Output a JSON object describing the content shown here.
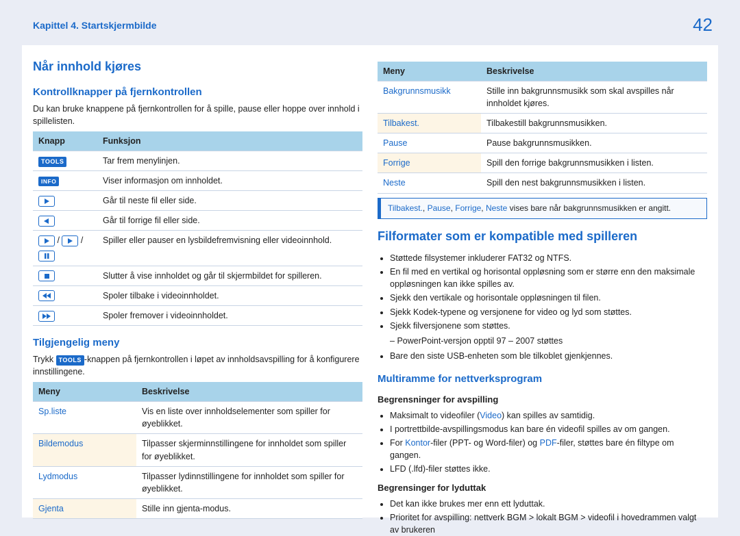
{
  "header": {
    "chapter": "Kapittel 4. Startskjermbilde",
    "page_number": "42"
  },
  "left": {
    "h1": "Når innhold kjøres",
    "h2a": "Kontrollknapper på fjernkontrollen",
    "intro": "Du kan bruke knappene på fjernkontrollen for å spille, pause eller hoppe over innhold i spillelisten.",
    "table1": {
      "col1": "Knapp",
      "col2": "Funksjon",
      "rows": [
        {
          "k": "TOOLS",
          "v": "Tar frem menylinjen."
        },
        {
          "k": "INFO",
          "v": "Viser informasjon om innholdet."
        },
        {
          "k": "next",
          "v": "Går til neste fil eller side."
        },
        {
          "k": "prev",
          "v": "Går til forrige fil eller side."
        },
        {
          "k": "playset",
          "v": "Spiller eller pauser en lysbildefremvisning eller videoinnhold."
        },
        {
          "k": "stop",
          "v": "Slutter å vise innholdet og går til skjermbildet for spilleren."
        },
        {
          "k": "rew",
          "v": "Spoler tilbake i videoinnholdet."
        },
        {
          "k": "ff",
          "v": "Spoler fremover i videoinnholdet."
        }
      ]
    },
    "h2b": "Tilgjengelig meny",
    "tool_sentence_a": "Trykk ",
    "tool_sentence_b": "-knappen på fjernkontrollen i løpet av innholdsavspilling for å konfigurere innstillingene.",
    "table2": {
      "col1": "Meny",
      "col2": "Beskrivelse",
      "rows": [
        {
          "k": "Sp.liste",
          "v": "Vis en liste over innholdselementer som spiller for øyeblikket."
        },
        {
          "k": "Bildemodus",
          "v": "Tilpasser skjerminnstillingene for innholdet som spiller for øyeblikket."
        },
        {
          "k": "Lydmodus",
          "v": "Tilpasser lydinnstillingene for innholdet som spiller for øyeblikket."
        },
        {
          "k": "Gjenta",
          "v": "Stille inn gjenta-modus."
        }
      ]
    }
  },
  "right": {
    "table3": {
      "col1": "Meny",
      "col2": "Beskrivelse",
      "rows": [
        {
          "k": "Bakgrunnsmusikk",
          "v": "Stille inn bakgrunnsmusikk som skal avspilles når innholdet kjøres."
        },
        {
          "k": "Tilbakest.",
          "v": "Tilbakestill bakgrunnsmusikken."
        },
        {
          "k": "Pause",
          "v": "Pause bakgrunnsmusikken."
        },
        {
          "k": "Forrige",
          "v": "Spill den forrige bakgrunnsmusikken i listen."
        },
        {
          "k": "Neste",
          "v": "Spill den nest bakgrunnsmusikken i listen."
        }
      ]
    },
    "note_items": {
      "a": "Tilbakest.",
      "b": "Pause",
      "c": "Forrige",
      "d": "Neste"
    },
    "note_tail": " vises bare når bakgrunnsmusikken er angitt.",
    "h1": "Filformater som er kompatible med spilleren",
    "bullets": [
      "Støttede filsystemer inkluderer FAT32 og NTFS.",
      "En fil med en vertikal og horisontal oppløsning som er større enn den maksimale oppløsningen kan ikke spilles av.",
      "Sjekk den vertikale og horisontale oppløsningen til filen.",
      "Sjekk Kodek-typene og versjonene for video og lyd som støttes.",
      "Sjekk filversjonene som støttes."
    ],
    "sub_bullet": "PowerPoint-versjon opptil 97 – 2007 støttes",
    "last_bullet": "Bare den siste USB-enheten som ble tilkoblet gjenkjennes.",
    "h2": "Multiramme for nettverksprogram",
    "h3a": "Begrensninger for avspilling",
    "play_bullets_pre1": "Maksimalt to videofiler (",
    "video_word": "Video",
    "play_bullets_post1": ") kan spilles av samtidig.",
    "play_bullet2": "I portrettbilde-avspillingsmodus kan bare én videofil spilles av om gangen.",
    "play_bullets_pre3a": "For ",
    "kontor_word": "Kontor",
    "play_bullets_pre3b": "-filer (PPT- og Word-filer) og ",
    "pdf_word": "PDF",
    "play_bullets_post3": "-filer, støttes bare én filtype om gangen.",
    "play_bullet4": "LFD (.lfd)-filer støttes ikke.",
    "h3b": "Begrensinger for lyduttak",
    "audio_bullets": [
      "Det kan ikke brukes mer enn ett lyduttak.",
      "Prioritet for avspilling: nettverk BGM > lokalt BGM > videofil i hovedrammen valgt av brukeren"
    ]
  }
}
